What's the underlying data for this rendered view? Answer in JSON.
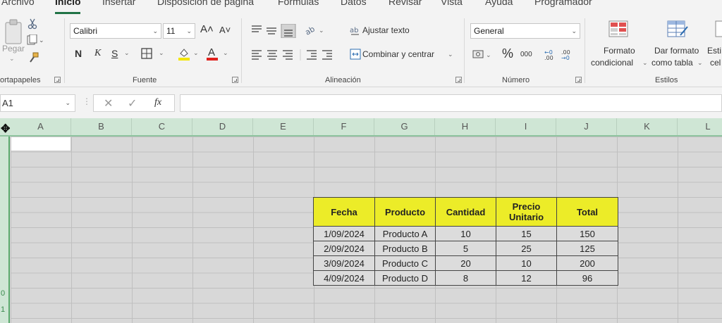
{
  "tabs": [
    {
      "label": "Archivo",
      "active": false
    },
    {
      "label": "Inicio",
      "active": true
    },
    {
      "label": "Insertar",
      "active": false
    },
    {
      "label": "Disposición de página",
      "active": false
    },
    {
      "label": "Fórmulas",
      "active": false
    },
    {
      "label": "Datos",
      "active": false
    },
    {
      "label": "Revisar",
      "active": false
    },
    {
      "label": "Vista",
      "active": false
    },
    {
      "label": "Ayuda",
      "active": false
    },
    {
      "label": "Programador",
      "active": false
    }
  ],
  "ribbon": {
    "clipboard": {
      "paste_label": "Pegar",
      "group_label": "ortapapeles"
    },
    "font": {
      "name": "Calibri",
      "size": "11",
      "bold": "N",
      "italic": "K",
      "underline": "S",
      "group_label": "Fuente"
    },
    "alignment": {
      "wrap_text": "Ajustar texto",
      "merge_center": "Combinar y centrar",
      "group_label": "Alineación"
    },
    "number": {
      "format": "General",
      "percent": "%",
      "thousands": "000",
      "group_label": "Número"
    },
    "styles": {
      "conditional_line1": "Formato",
      "conditional_line2": "condicional",
      "as_table_line1": "Dar formato",
      "as_table_line2": "como tabla",
      "cell_line1": "Esti",
      "cell_line2": "cel",
      "group_label": "Estilos"
    }
  },
  "formula_bar": {
    "name_box": "A1",
    "fx": "fx",
    "value": ""
  },
  "columns": [
    "A",
    "B",
    "C",
    "D",
    "E",
    "F",
    "G",
    "H",
    "I",
    "J",
    "K",
    "L"
  ],
  "row_numbers": [
    "",
    "",
    "",
    "",
    "",
    "",
    "",
    "",
    "",
    "0",
    "1"
  ],
  "table": {
    "headers": [
      "Fecha",
      "Producto",
      "Cantidad",
      "Precio Unitario",
      "Total"
    ],
    "rows": [
      [
        "1/09/2024",
        "Producto A",
        "10",
        "15",
        "150"
      ],
      [
        "2/09/2024",
        "Producto B",
        "5",
        "25",
        "125"
      ],
      [
        "3/09/2024",
        "Producto C",
        "20",
        "10",
        "200"
      ],
      [
        "4/09/2024",
        "Producto D",
        "8",
        "12",
        "96"
      ]
    ]
  },
  "colors": {
    "accent": "#217346",
    "header_fill": "#ecec28"
  }
}
